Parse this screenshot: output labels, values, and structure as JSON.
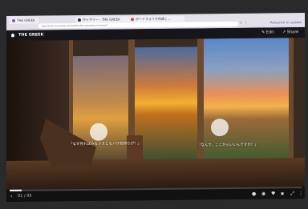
{
  "browser": {
    "tabs": [
      {
        "label": "THE GREEK",
        "color": "#7c5cc4"
      },
      {
        "label": "ギャラリー - THE GREEK",
        "color": "#333333"
      },
      {
        "label": "ポートフォリオ作成 | ...",
        "color": "#e0403a"
      }
    ],
    "url": "app.studio.example.com/editor/the-greek/tour/scene/1",
    "right_label": "Relaunch to update"
  },
  "app": {
    "title": "THE GREEK",
    "edit_label": "Edit",
    "share_label": "Share"
  },
  "captions": {
    "left": "「なぜ見ればみなさまともハサ気持ちが？」",
    "right": "「なんで、ここからいいんですか？」"
  },
  "footer": {
    "counter": "01 / 05",
    "progress_fraction": 0.04
  }
}
